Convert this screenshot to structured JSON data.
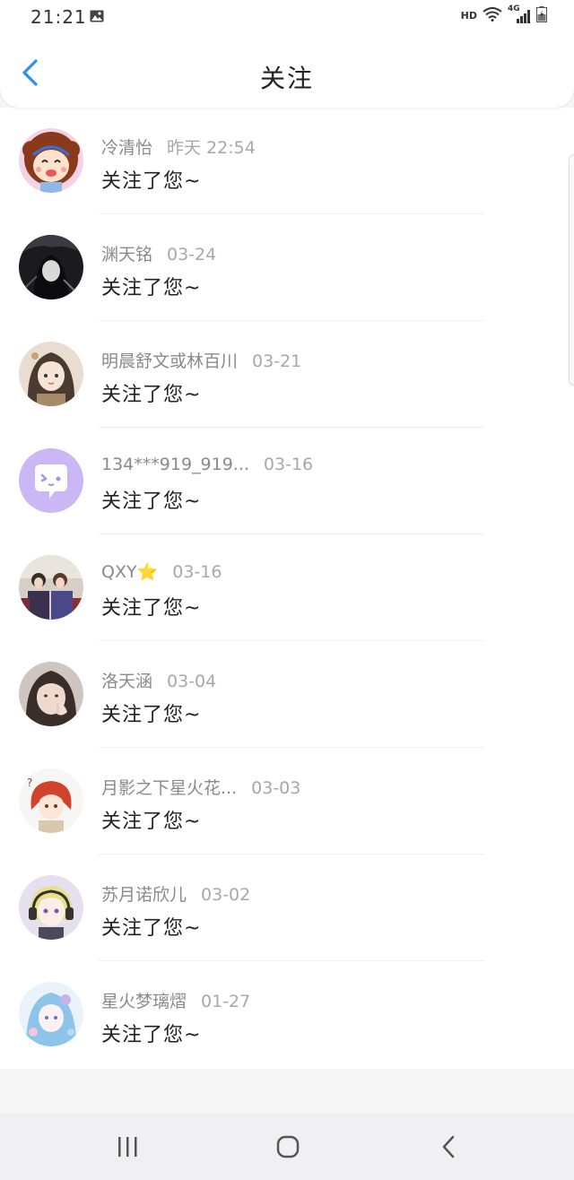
{
  "status_bar": {
    "time": "21:21",
    "network_label": "HD",
    "cell_label": "4G"
  },
  "header": {
    "title": "关注"
  },
  "notifications": [
    {
      "name": "冷清怡",
      "date": "昨天 22:54",
      "message": "关注了您~",
      "avatar": "cartoon-girl-avatar"
    },
    {
      "name": "渊天铭",
      "date": "03-24",
      "message": "关注了您~",
      "avatar": "dark-hooded-avatar"
    },
    {
      "name": "明晨舒文或林百川",
      "date": "03-21",
      "message": "关注了您~",
      "avatar": "anime-girl-avatar"
    },
    {
      "name": "134***919_919...",
      "date": "03-16",
      "message": "关注了您~",
      "avatar": "chat-bubble-avatar"
    },
    {
      "name": "QXY⭐",
      "date": "03-16",
      "message": "关注了您~",
      "avatar": "group-photo-avatar"
    },
    {
      "name": "洛天涵",
      "date": "03-04",
      "message": "关注了您~",
      "avatar": "photo-girl-avatar"
    },
    {
      "name": "月影之下星火花...",
      "date": "03-03",
      "message": "关注了您~",
      "avatar": "red-hair-anime-avatar"
    },
    {
      "name": "苏月诺欣儿",
      "date": "03-02",
      "message": "关注了您~",
      "avatar": "headphone-anime-avatar"
    },
    {
      "name": "星火梦璃熠",
      "date": "01-27",
      "message": "关注了您~",
      "avatar": "blue-anime-avatar"
    }
  ],
  "colors": {
    "accent": "#2f8ff0",
    "avatar_purple": "#c9b8f5"
  }
}
